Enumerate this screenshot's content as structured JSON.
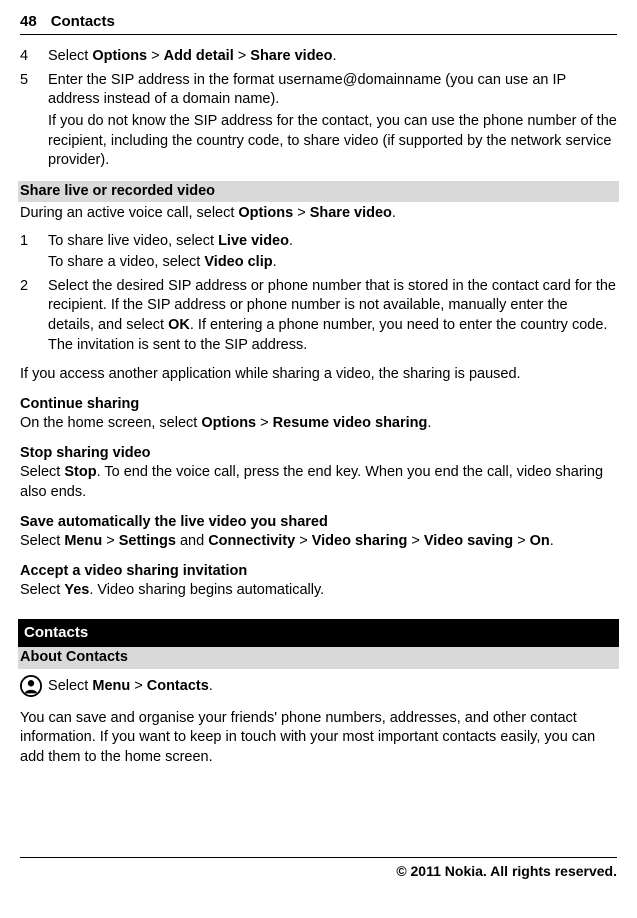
{
  "header": {
    "page": "48",
    "chapter": "Contacts"
  },
  "s4": {
    "num": "4",
    "pre": "Select ",
    "b1": "Options",
    "sep1": " > ",
    "b2": "Add detail",
    "sep2": " > ",
    "b3": "Share video",
    "post": "."
  },
  "s5": {
    "num": "5",
    "line1": "Enter the SIP address in the format username@domainname (you can use an IP address instead of a domain name).",
    "line2": "If you do not know the SIP address for the contact, you can use the phone number of the recipient, including the country code, to share video (if supported by the network service provider)."
  },
  "shareBar": "Share live or recorded video",
  "shareIntro": {
    "p1": "During an active voice call, select ",
    "b1": "Options",
    "sep": " > ",
    "b2": "Share video",
    "post": "."
  },
  "ss1": {
    "num": "1",
    "l1p": "To share live video, select ",
    "l1b": "Live video",
    "l1post": ".",
    "l2p": "To share a video, select ",
    "l2b": "Video clip",
    "l2post": "."
  },
  "ss2": {
    "num": "2",
    "t1": "Select the desired SIP address or phone number that is stored in the contact card for the recipient. If the SIP address or phone number is not available, manually enter the details, and select ",
    "b": "OK",
    "t2": ". If entering a phone number, you need to enter the country code. The invitation is sent to the SIP address."
  },
  "pausedNote": "If you access another application while sharing a video, the sharing is paused.",
  "cont": {
    "head": "Continue sharing",
    "p1": "On the home screen, select ",
    "b1": "Options",
    "sep": " > ",
    "b2": "Resume video sharing",
    "post": "."
  },
  "stop": {
    "head": "Stop sharing video",
    "p1": "Select ",
    "b": "Stop",
    "p2": ". To end the voice call, press the end key. When you end the call, video sharing also ends."
  },
  "save": {
    "head": "Save automatically the live video you shared",
    "p1": "Select ",
    "b1": "Menu",
    "sep1": " > ",
    "b2": "Settings",
    "mid": " and ",
    "b3": "Connectivity",
    "sep2": " > ",
    "b4": "Video sharing",
    "sep3": " > ",
    "b5": "Video saving",
    "sep4": " > ",
    "b6": "On",
    "post": "."
  },
  "accept": {
    "head": "Accept a video sharing invitation",
    "p1": "Select ",
    "b": "Yes",
    "p2": ". Video sharing begins automatically."
  },
  "blackBar": "Contacts",
  "aboutBar": "About Contacts",
  "menuRow": {
    "p1": " Select ",
    "b1": "Menu",
    "sep": " > ",
    "b2": "Contacts",
    "post": "."
  },
  "aboutBody": "You can save and organise your friends' phone numbers, addresses, and other contact information. If you want to keep in touch with your most important contacts easily, you can add them to the home screen.",
  "footer": "© 2011 Nokia. All rights reserved."
}
